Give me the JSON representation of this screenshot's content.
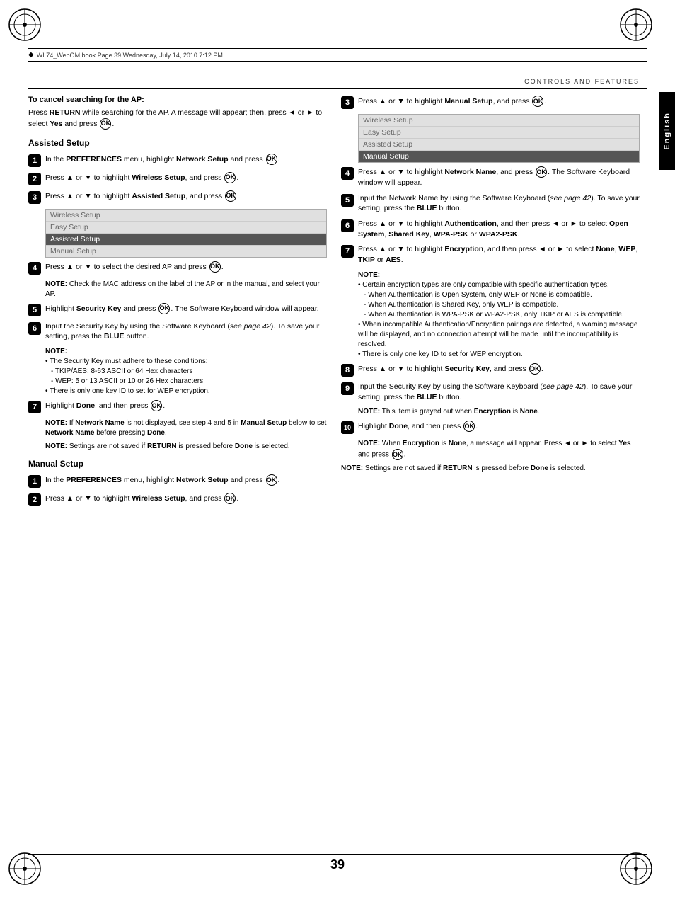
{
  "header": {
    "file_info": "WL74_WebOM.book  Page 39  Wednesday, July 14, 2010  7:12 PM",
    "controls_label": "CONTROLS AND FEATURES",
    "lang_tab": "English"
  },
  "page_number": "39",
  "left_column": {
    "cancel_section": {
      "heading": "To cancel searching for the AP:",
      "text": "Press RETURN while searching for the AP. A message will appear; then, press ◄ or ► to select Yes and press OK."
    },
    "assisted_setup": {
      "title": "Assisted Setup",
      "steps": [
        {
          "num": "1",
          "text": "In the PREFERENCES menu, highlight Network Setup and press OK."
        },
        {
          "num": "2",
          "text": "Press ▲ or ▼ to highlight Wireless Setup, and press OK."
        },
        {
          "num": "3",
          "text": "Press ▲ or ▼ to highlight Assisted Setup, and press OK."
        }
      ],
      "menu": [
        "Wireless Setup",
        "Easy Setup",
        "Assisted Setup",
        "Manual Setup"
      ],
      "menu_selected": "Assisted Setup",
      "steps2": [
        {
          "num": "4",
          "text": "Press ▲ or ▼ to select the desired AP and press OK."
        }
      ],
      "note4": "NOTE: Check the MAC address on the label of the AP or in the manual, and select your AP.",
      "steps3": [
        {
          "num": "5",
          "text": "Highlight Security Key and press OK. The Software Keyboard window will appear."
        },
        {
          "num": "6",
          "text": "Input the Security Key by using the Software Keyboard (see page 42). To save your setting, press the BLUE button."
        }
      ],
      "note6_label": "NOTE:",
      "note6_items": [
        "The Security Key must adhere to these conditions:",
        "- TKIP/AES: 8-63 ASCII or 64 Hex characters",
        "- WEP: 5 or 13 ASCII or 10 or 26 Hex characters",
        "There is only one key ID to set for WEP encryption."
      ],
      "steps4": [
        {
          "num": "7",
          "text": "Highlight Done, and then press OK."
        }
      ],
      "note7": "NOTE: If Network Name is not displayed, see step 4 and 5 in Manual Setup below to set Network Name before pressing Done.",
      "note_final": "NOTE: Settings are not saved if RETURN is pressed before Done is selected."
    },
    "manual_setup": {
      "title": "Manual Setup",
      "steps": [
        {
          "num": "1",
          "text": "In the PREFERENCES menu, highlight Network Setup and press OK."
        },
        {
          "num": "2",
          "text": "Press ▲ or ▼ to highlight Wireless Setup, and press OK."
        }
      ]
    }
  },
  "right_column": {
    "step3": {
      "num": "3",
      "text": "Press ▲ or ▼ to highlight Manual Setup, and press OK."
    },
    "menu": [
      "Wireless Setup",
      "Easy Setup",
      "Assisted Setup",
      "Manual Setup"
    ],
    "menu_selected": "Manual Setup",
    "steps": [
      {
        "num": "4",
        "text": "Press ▲ or ▼ to highlight Network Name, and press OK. The Software Keyboard window will appear."
      },
      {
        "num": "5",
        "text": "Input the Network Name by using the Software Keyboard (see page 42). To save your setting, press the BLUE button."
      },
      {
        "num": "6",
        "text": "Press ▲ or ▼ to highlight Authentication, and then press ◄ or ► to select Open System, Shared Key, WPA-PSK or WPA2-PSK."
      },
      {
        "num": "7",
        "text": "Press ▲ or ▼ to highlight Encryption, and then press ◄ or ► to select None, WEP, TKIP or AES."
      }
    ],
    "note7_label": "NOTE:",
    "note7_items": [
      "Certain encryption types are only compatible with specific authentication types.",
      "- When Authentication is Open System, only WEP or None is compatible.",
      "- When Authentication is Shared Key, only WEP is compatible.",
      "- When Authentication is WPA-PSK or WPA2-PSK, only TKIP or AES is compatible.",
      "When incompatible Authentication/Encryption pairings are detected, a warning message will be displayed, and no connection attempt will be made until the incompatibility is resolved.",
      "There is only one key ID to set for WEP encryption."
    ],
    "steps2": [
      {
        "num": "8",
        "text": "Press ▲ or ▼ to highlight Security Key, and press OK."
      },
      {
        "num": "9",
        "text": "Input the Security Key by using the Software Keyboard (see page 42). To save your setting, press the BLUE button."
      }
    ],
    "note9": "NOTE: This item is grayed out when Encryption is None.",
    "step10": {
      "num": "10",
      "text": "Highlight Done, and then press OK."
    },
    "note10": "NOTE: When Encryption is None, a message will appear. Press ◄ or ► to select Yes and press OK.",
    "note_final": "NOTE: Settings are not saved if RETURN is pressed before Done is selected."
  }
}
